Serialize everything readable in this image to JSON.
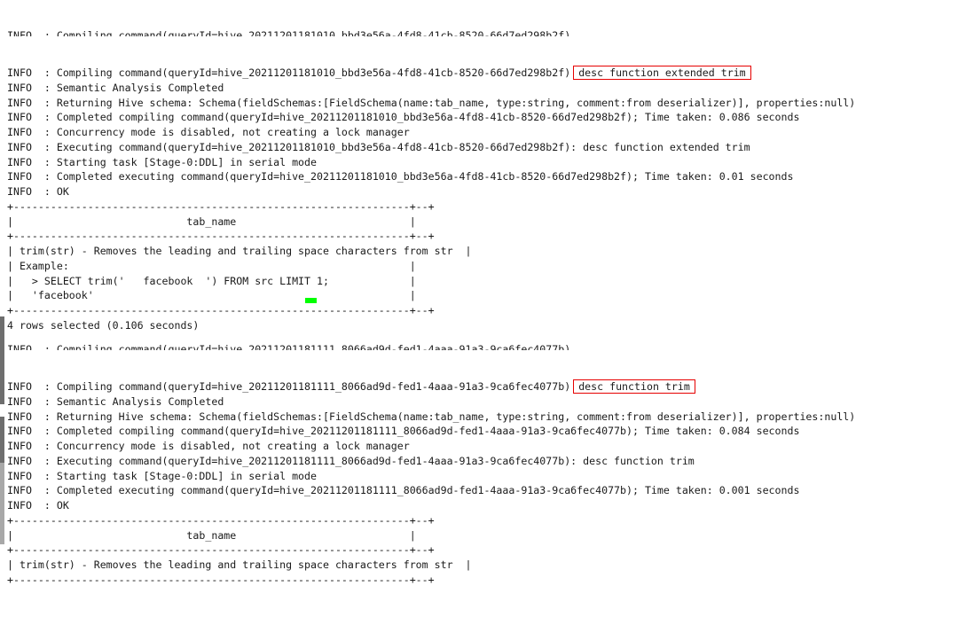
{
  "colors": {
    "background": "#ffffff",
    "text": "#1a1a1a",
    "highlight_border": "#e60000",
    "marker_green": "#00ff00",
    "gutter": "#6e6e6e"
  },
  "block_one": {
    "clipped_top_line": "INFO  : Compiling command(queryId=hive_20211201181010_bbd3e56a-4fd8-41cb-8520-66d7ed298b2f)",
    "lines": [
      {
        "text": "INFO  : Compiling command(queryId=hive_20211201181010_bbd3e56a-4fd8-41cb-8520-66d7ed298b2f)",
        "highlight": "desc function extended trim"
      },
      {
        "text": "INFO  : Semantic Analysis Completed",
        "highlight": ""
      },
      {
        "text": "INFO  : Returning Hive schema: Schema(fieldSchemas:[FieldSchema(name:tab_name, type:string, comment:from deserializer)], properties:null)",
        "highlight": ""
      },
      {
        "text": "INFO  : Completed compiling command(queryId=hive_20211201181010_bbd3e56a-4fd8-41cb-8520-66d7ed298b2f); Time taken: 0.086 seconds",
        "highlight": ""
      },
      {
        "text": "INFO  : Concurrency mode is disabled, not creating a lock manager",
        "highlight": ""
      },
      {
        "text": "INFO  : Executing command(queryId=hive_20211201181010_bbd3e56a-4fd8-41cb-8520-66d7ed298b2f): desc function extended trim",
        "highlight": ""
      },
      {
        "text": "INFO  : Starting task [Stage-0:DDL] in serial mode",
        "highlight": ""
      },
      {
        "text": "INFO  : Completed executing command(queryId=hive_20211201181010_bbd3e56a-4fd8-41cb-8520-66d7ed298b2f); Time taken: 0.01 seconds",
        "highlight": ""
      },
      {
        "text": "INFO  : OK",
        "highlight": ""
      },
      {
        "text": "+----------------------------------------------------------------+--+",
        "highlight": ""
      },
      {
        "text": "|                            tab_name                            |",
        "highlight": ""
      },
      {
        "text": "+----------------------------------------------------------------+--+",
        "highlight": ""
      },
      {
        "text": "| trim(str) - Removes the leading and trailing space characters from str  |",
        "highlight": ""
      },
      {
        "text": "| Example:                                                       |",
        "highlight": ""
      },
      {
        "text": "|   > SELECT trim('   facebook  ') FROM src LIMIT 1;             |",
        "highlight": ""
      },
      {
        "text": "|   'facebook'                                                   |",
        "highlight": ""
      },
      {
        "text": "+----------------------------------------------------------------+--+",
        "highlight": ""
      },
      {
        "text": "4 rows selected (0.106 seconds)",
        "highlight": ""
      }
    ]
  },
  "block_two": {
    "clipped_top_line": "INFO  : Compiling command(queryId=hive_20211201181111_8066ad9d-fed1-4aaa-91a3-9ca6fec4077b)",
    "lines": [
      {
        "text": "INFO  : Compiling command(queryId=hive_20211201181111_8066ad9d-fed1-4aaa-91a3-9ca6fec4077b)",
        "highlight": "desc function trim"
      },
      {
        "text": "INFO  : Semantic Analysis Completed",
        "highlight": ""
      },
      {
        "text": "INFO  : Returning Hive schema: Schema(fieldSchemas:[FieldSchema(name:tab_name, type:string, comment:from deserializer)], properties:null)",
        "highlight": ""
      },
      {
        "text": "INFO  : Completed compiling command(queryId=hive_20211201181111_8066ad9d-fed1-4aaa-91a3-9ca6fec4077b); Time taken: 0.084 seconds",
        "highlight": ""
      },
      {
        "text": "INFO  : Concurrency mode is disabled, not creating a lock manager",
        "highlight": ""
      },
      {
        "text": "INFO  : Executing command(queryId=hive_20211201181111_8066ad9d-fed1-4aaa-91a3-9ca6fec4077b): desc function trim",
        "highlight": ""
      },
      {
        "text": "INFO  : Starting task [Stage-0:DDL] in serial mode",
        "highlight": ""
      },
      {
        "text": "INFO  : Completed executing command(queryId=hive_20211201181111_8066ad9d-fed1-4aaa-91a3-9ca6fec4077b); Time taken: 0.001 seconds",
        "highlight": ""
      },
      {
        "text": "INFO  : OK",
        "highlight": ""
      },
      {
        "text": "+----------------------------------------------------------------+--+",
        "highlight": ""
      },
      {
        "text": "|                            tab_name                            |",
        "highlight": ""
      },
      {
        "text": "+----------------------------------------------------------------+--+",
        "highlight": ""
      },
      {
        "text": "| trim(str) - Removes the leading and trailing space characters from str  |",
        "highlight": ""
      },
      {
        "text": "+----------------------------------------------------------------+--+",
        "highlight": ""
      }
    ]
  }
}
